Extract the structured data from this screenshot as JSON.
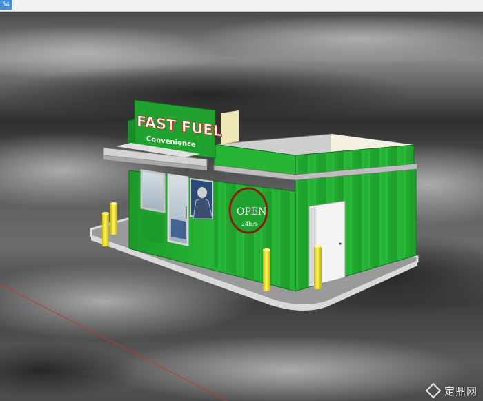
{
  "window": {
    "tab_label": "54"
  },
  "sign": {
    "brand": "FAST FUEL",
    "sub": "Convenience"
  },
  "open_sign": {
    "line1": "OPEN",
    "line2": "24hrs"
  },
  "watermark": {
    "text": "定鼎网",
    "logo_icon": "diamond-logo-icon"
  },
  "colors": {
    "building_green": "#1fa32e",
    "sky": "#5a5a5a",
    "bollard_yellow": "#f2e21a",
    "axis_red": "#c0392b"
  }
}
